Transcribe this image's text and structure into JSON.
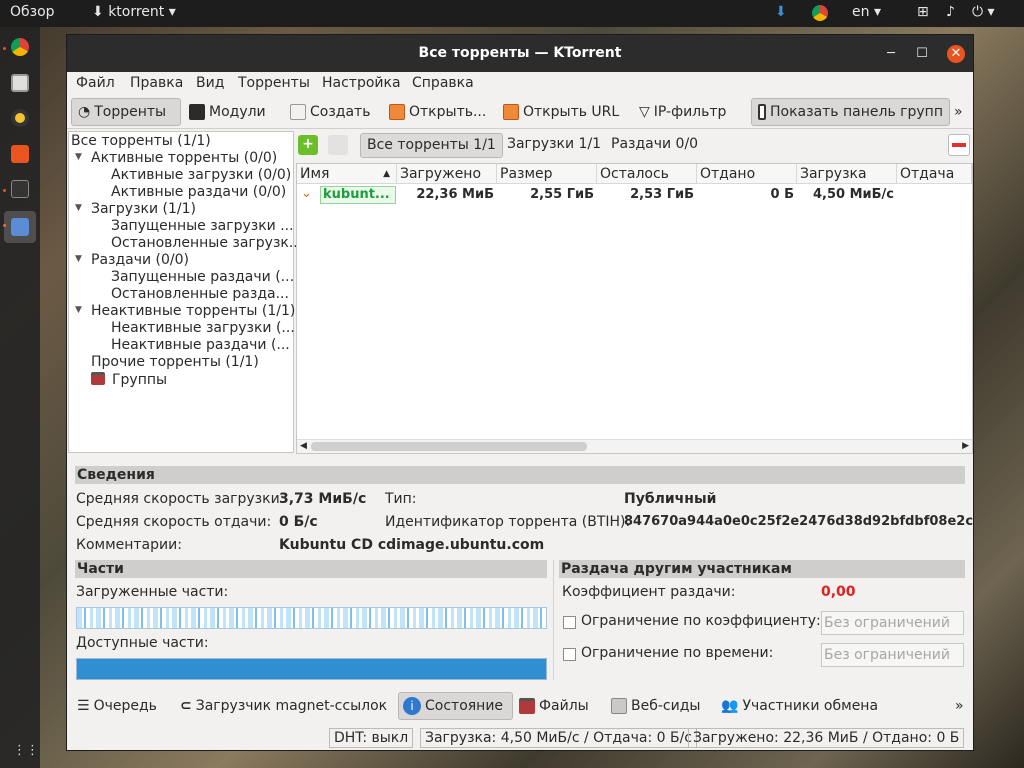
{
  "topbar": {
    "overview": "Обзор",
    "app_name": "ktorrent",
    "lang": "en"
  },
  "window": {
    "title": "Все торренты — KTorrent"
  },
  "menu": [
    "Файл",
    "Правка",
    "Вид",
    "Торренты",
    "Настройка",
    "Справка"
  ],
  "toolbar": {
    "torrents": "Торренты",
    "modules": "Модули",
    "create": "Создать",
    "open": "Открыть...",
    "open_url": "Открыть URL",
    "ip_filter": "IP-фильтр",
    "show_group_panel": "Показать панель групп",
    "more": "»"
  },
  "tree": {
    "all": "Все торренты (1/1)",
    "active": "Активные торренты (0/0)",
    "active_dl": "Активные загрузки (0/0)",
    "active_ul": "Активные раздачи (0/0)",
    "downloads": "Загрузки (1/1)",
    "running_dl": "Запущенные загрузки ...",
    "stopped_dl": "Остановленные загрузк...",
    "uploads": "Раздачи (0/0)",
    "running_ul": "Запущенные раздачи (...",
    "stopped_ul": "Остановленные разда...",
    "inactive": "Неактивные торренты (1/1)",
    "inactive_dl": "Неактивные загрузки (...",
    "inactive_ul": "Неактивные раздачи (...",
    "other": "Прочие торренты (1/1)",
    "groups": "Группы"
  },
  "filter": {
    "all": "Все торренты 1/1",
    "downloads": "Загрузки 1/1",
    "uploads": "Раздачи 0/0"
  },
  "grid": {
    "headers": [
      "Имя",
      "Загружено",
      "Размер",
      "Осталось",
      "Отдано",
      "Загрузка",
      "Отдача"
    ],
    "row": {
      "name": "kubunt...",
      "downloaded": "22,36 МиБ",
      "size": "2,55 ГиБ",
      "left": "2,53 ГиБ",
      "uploaded": "0 Б",
      "down_speed": "4,50 МиБ/с"
    }
  },
  "details": {
    "info_header": "Сведения",
    "avg_down_label": "Средняя скорость загрузки:",
    "avg_down_value": "3,73 МиБ/с",
    "avg_up_label": "Средняя скорость отдачи:",
    "avg_up_value": "0 Б/с",
    "comment_label": "Комментарии:",
    "comment_value": "Kubuntu CD cdimage.ubuntu.com",
    "type_label": "Тип:",
    "type_value": "Публичный",
    "hash_label": "Идентификатор торрента (BTIH):",
    "hash_value": "847670a944a0e0c25f2e2476d38d92bfdbf08e2c",
    "pieces_header": "Части",
    "downloaded_pieces": "Загруженные части:",
    "available_pieces": "Доступные части:",
    "seeding_header": "Раздача другим участникам",
    "ratio_label": "Коэффициент раздачи:",
    "ratio_value": "0,00",
    "ratio_limit_label": "Ограничение по коэффициенту:",
    "time_limit_label": "Ограничение по времени:",
    "no_limit": "Без ограничений"
  },
  "bottom_tabs": {
    "queue": "Очередь",
    "magnet": "Загрузчик magnet-ссылок",
    "status": "Состояние",
    "files": "Файлы",
    "webseeds": "Веб-сиды",
    "peers": "Участники обмена",
    "more": "»"
  },
  "statusbar": {
    "dht": "DHT: выкл",
    "speed": "Загрузка: 4,50 МиБ/с / Отдача: 0 Б/с",
    "totals": "Загружено: 22,36 МиБ / Отдано: 0 Б"
  },
  "colors": {
    "ratio": "#e02020",
    "progress": "#2f8fd0",
    "name_green": "#1d9e3a"
  }
}
